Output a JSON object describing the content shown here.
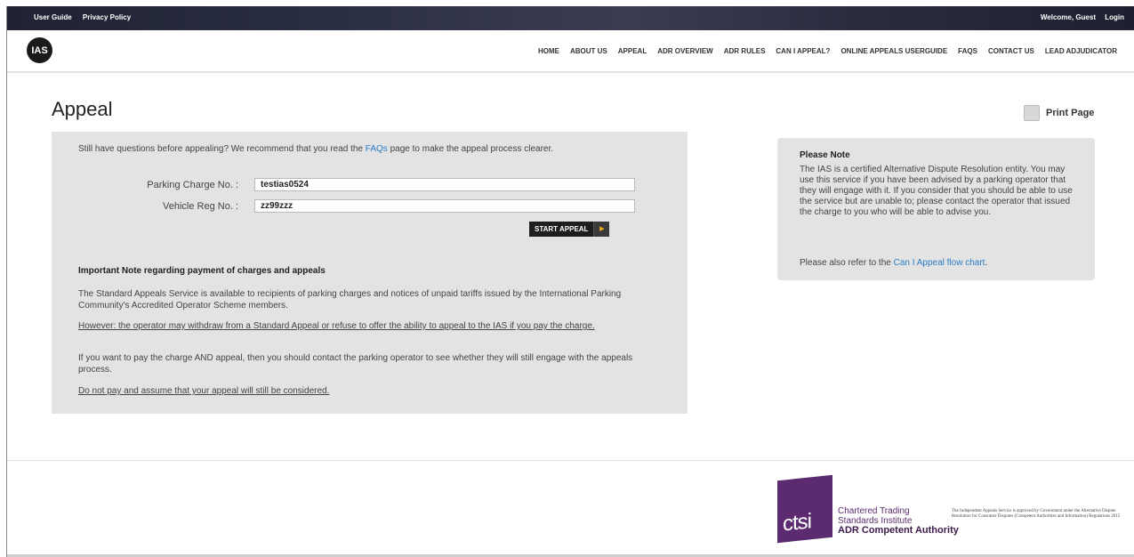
{
  "topbar": {
    "links": [
      "User Guide",
      "Privacy Policy"
    ],
    "welcome": "Welcome, Guest",
    "login": "Login"
  },
  "logo": "IAS",
  "nav": [
    "HOME",
    "ABOUT US",
    "APPEAL",
    "ADR OVERVIEW",
    "ADR RULES",
    "CAN I APPEAL?",
    "ONLINE APPEALS USERGUIDE",
    "FAQS",
    "CONTACT US",
    "LEAD ADJUDICATOR"
  ],
  "page": {
    "title": "Appeal",
    "print_label": "Print Page"
  },
  "form": {
    "intro_before": "Still have questions before appealing? We recommend that you read the ",
    "intro_link": "FAQs",
    "intro_after": " page to make the appeal process clearer.",
    "pcn_label": "Parking Charge No. :",
    "pcn_value": "testias0524",
    "reg_label": "Vehicle Reg No. :",
    "reg_value": "zz99zzz",
    "start_button": "START APPEAL"
  },
  "important": {
    "title": "Important Note regarding payment of charges and appeals",
    "p1": "The Standard Appeals Service is available to recipients of parking charges and notices of unpaid tariffs issued by the International Parking Community's Accredited Operator Scheme members.",
    "p2": "However: the operator may withdraw from a Standard Appeal or refuse to offer the ability to appeal to the IAS if you pay the charge.",
    "p3": "If you want to pay the charge AND appeal, then you should contact the parking operator to see whether they will still engage with the appeals process.",
    "p4": "Do not pay and assume that your appeal will still be considered."
  },
  "sidebar": {
    "title": "Please Note",
    "text": "The IAS is a certified Alternative Dispute Resolution entity. You may use this service if you have been advised by a parking operator that they will engage with it. If you consider that you should be able to use the service but are unable to; please contact the operator that issued the charge to you who will be able to advise you.",
    "refer_before": "Please also refer to the ",
    "refer_link": "Can I Appeal flow chart",
    "refer_after": "."
  },
  "footer": {
    "ctsi_logo": "ctsi",
    "ctsi_line1": "Chartered Trading",
    "ctsi_line2": "Standards Institute",
    "ctsi_line3": "ADR Competent Authority",
    "gov_text": "The Independent Appeals Service is approved by Government under the Alternative Dispute Resolution for Consumer Disputes (Competent Authorities and Information) Regulations 2015"
  }
}
